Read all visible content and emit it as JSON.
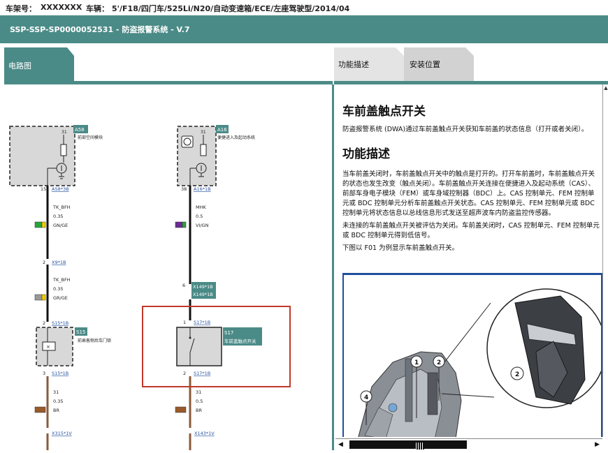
{
  "header": {
    "vin_label": "车架号：",
    "vin_value": "XXXXXXX",
    "vehicle_label": "车辆：",
    "vehicle_value": "5'/F18/四门车/525Li/N20/自动变速箱/ECE/左座驾驶型/2014/04"
  },
  "title": "SSP-SSP-SP0000052531 - 防盗报警系统 - V.7",
  "tabs": {
    "left": "电路图",
    "right": [
      "功能描述",
      "安装位置"
    ]
  },
  "article": {
    "heading": "车前盖触点开关",
    "intro": "防盗报警系统 (DWA)通过车前盖触点开关获知车前盖的状态信息（打开或者关闭）。",
    "section_heading": "功能描述",
    "paragraphs": [
      "当车前盖关闭时，车前盖触点开关中的触点是打开的。打开车前盖时，车前盖触点开关的状态也发生改变（触点关闭）。车前盖触点开关连接在便捷进入及起动系统（CAS）、前部车身电子模块（FEM）或车身域控制器（BDC）上。CAS 控制单元、FEM 控制单元或 BDC 控制单元分析车前盖触点开关状态。CAS 控制单元、FEM 控制单元或 BDC 控制单元将状态信息以总线信息形式发送至超声波车内防盗监控传感器。",
      "未连接的车前盖触点开关被评估为关闭。车前盖关闭时，CAS 控制单元、FEM 控制单元或 BDC 控制单元得到低信号。",
      "下图以 F01 为例显示车前盖触点开关。"
    ],
    "figure_callouts": [
      "1",
      "2",
      "2",
      "4"
    ]
  },
  "diagram": {
    "left_column": {
      "module_id": "A58",
      "module_name": "前部空间模块",
      "pin_top": "31",
      "pin_left": "15",
      "connector": "A58*3B",
      "wire1_name": "TK_BFH",
      "wire1_size": "0.35",
      "wire1_color": "GN/GE",
      "pin_x9": "2",
      "conn_x9": "X9*1B",
      "wire2_name": "TK_BFH",
      "wire2_size": "0.35",
      "wire2_color": "GR/GE",
      "pin_s15_top": "2",
      "conn_s15_top": "S15*1B",
      "switch_id": "S15",
      "switch_name": "前乘客侧后车门锁",
      "pin_s15_bot": "3",
      "conn_s15_bot": "S15*1B",
      "wire3_name": "31",
      "wire3_size": "0.35",
      "wire3_color": "BR",
      "ground": "X315*1V"
    },
    "right_column": {
      "module_id": "A16",
      "module_name": "便捷进入及起动系统",
      "pin_top": "31",
      "pin_left": "38",
      "connector": "A16*1B",
      "wire1_name": "MHK",
      "wire1_size": "0.5",
      "wire1_color": "VI/GN",
      "pin_x149": "6",
      "conn_x149a": "X149*1B",
      "conn_x149b": "X149*1B",
      "pin_s17_top": "1",
      "conn_s17_top": "S17*1B",
      "switch_id": "S17",
      "switch_name": "车前盖触点开关",
      "pin_s17_bot": "2",
      "conn_s17_bot": "S17*1B",
      "wire2_name": "31",
      "wire2_size": "0.5",
      "wire2_color": "BR",
      "ground": "X143*1V"
    }
  },
  "colors": {
    "teal": "#4b8b87",
    "highlight": "#c0392b",
    "wire_brown": "#8b5a3c",
    "swatch_green": "#2aa33a",
    "swatch_yellow": "#f0d000",
    "swatch_grey": "#999999",
    "swatch_violet": "#6a2c91",
    "swatch_brown": "#9a5a2a"
  }
}
